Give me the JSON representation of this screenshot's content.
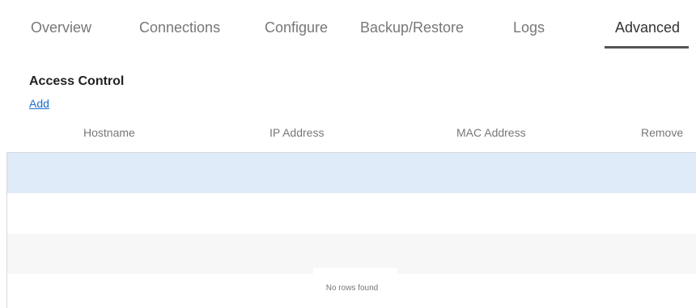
{
  "tabs": [
    {
      "label": "Overview"
    },
    {
      "label": "Connections"
    },
    {
      "label": "Configure"
    },
    {
      "label": "Backup/Restore"
    },
    {
      "label": "Logs"
    },
    {
      "label": "Advanced",
      "active": true
    }
  ],
  "section": {
    "title": "Access Control",
    "add_label": "Add"
  },
  "table": {
    "columns": [
      "Hostname",
      "IP Address",
      "MAC Address",
      "Remove"
    ],
    "rows": [],
    "empty_message": "No rows found"
  },
  "colors": {
    "selected_row": "#dfebf8",
    "link": "#1a6fd1",
    "active_tab_underline": "#555555"
  }
}
